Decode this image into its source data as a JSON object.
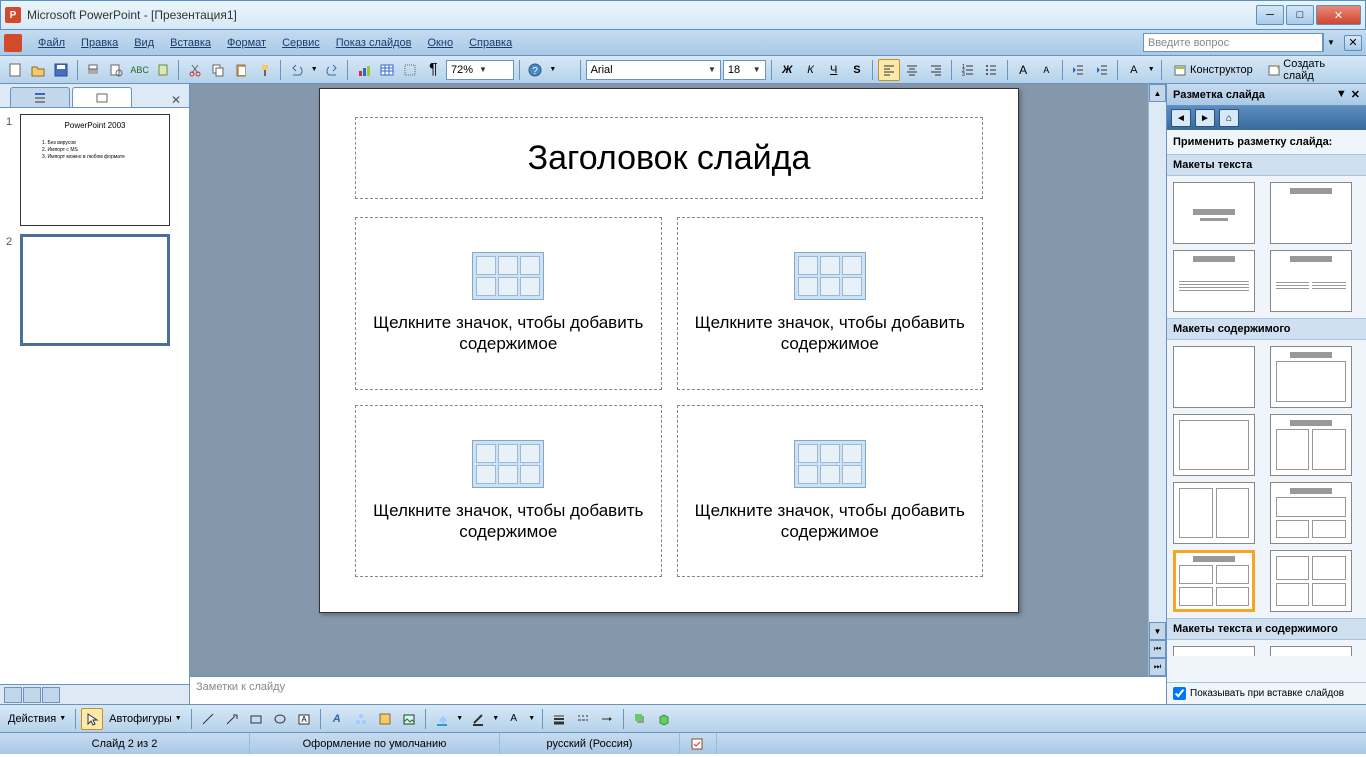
{
  "app": {
    "title": "Microsoft PowerPoint - [Презентация1]"
  },
  "menu": {
    "file": "Файл",
    "edit": "Правка",
    "view": "Вид",
    "insert": "Вставка",
    "format": "Формат",
    "tools": "Сервис",
    "slideshow": "Показ слайдов",
    "window": "Окно",
    "help": "Справка",
    "ask_placeholder": "Введите вопрос"
  },
  "toolbar": {
    "zoom": "72%",
    "font": "Arial",
    "size": "18",
    "designer": "Конструктор",
    "new_slide": "Создать слайд"
  },
  "thumbnails": {
    "slide1": {
      "num": "1",
      "title": "PowerPoint 2003",
      "b1": "1. Без вирусов",
      "b2": "2. Импорт с MS",
      "b3": "3. Импорт можно в любом формате"
    },
    "slide2": {
      "num": "2"
    }
  },
  "slide": {
    "title_placeholder": "Заголовок слайда",
    "content_placeholder": "Щелкните значок, чтобы добавить содержимое"
  },
  "notes": {
    "placeholder": "Заметки к слайду"
  },
  "taskpane": {
    "title": "Разметка слайда",
    "apply_label": "Применить разметку слайда:",
    "section_text": "Макеты текста",
    "section_content": "Макеты содержимого",
    "section_text_content": "Макеты текста и содержимого",
    "show_on_insert": "Показывать при вставке слайдов"
  },
  "drawing": {
    "actions": "Действия",
    "autoshapes": "Автофигуры"
  },
  "status": {
    "slide_info": "Слайд 2 из 2",
    "design": "Оформление по умолчанию",
    "language": "русский (Россия)"
  }
}
